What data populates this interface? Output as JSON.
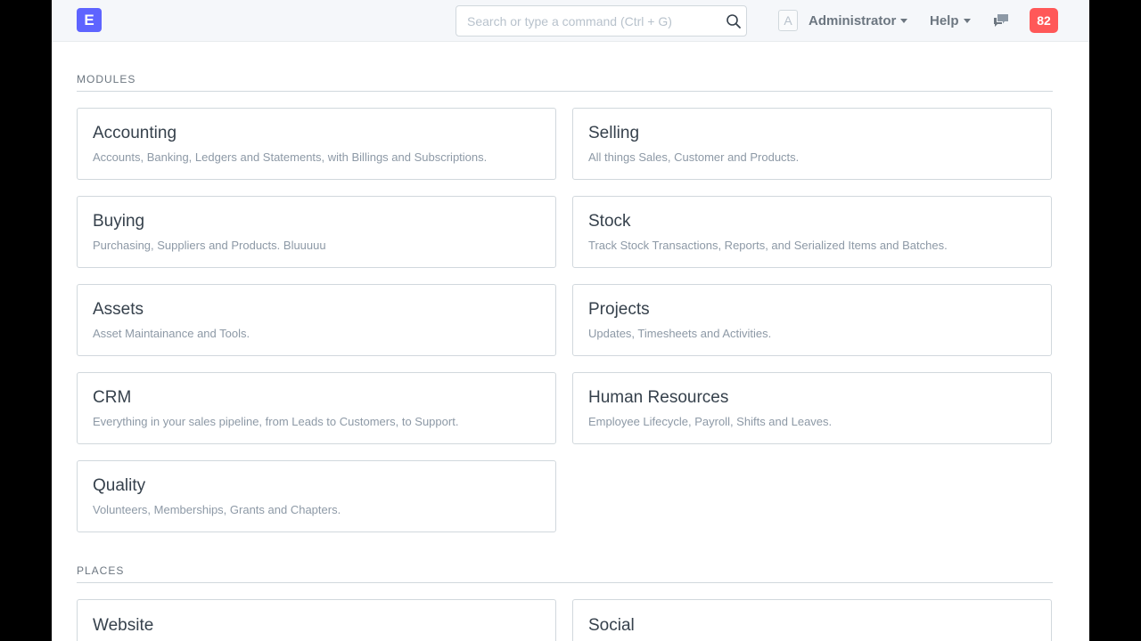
{
  "navbar": {
    "logo_letter": "E",
    "search_placeholder": "Search or type a command (Ctrl + G)",
    "avatar_letter": "A",
    "user_label": "Administrator",
    "help_label": "Help",
    "notification_count": "82",
    "colors": {
      "brand": "#5e64ff",
      "badge": "#ff5858"
    }
  },
  "sections": {
    "modules": {
      "heading": "MODULES",
      "cards": [
        {
          "title": "Accounting",
          "description": "Accounts, Banking, Ledgers and Statements, with Billings and Subscriptions."
        },
        {
          "title": "Selling",
          "description": "All things Sales, Customer and Products."
        },
        {
          "title": "Buying",
          "description": "Purchasing, Suppliers and Products. Bluuuuu"
        },
        {
          "title": "Stock",
          "description": "Track Stock Transactions, Reports, and Serialized Items and Batches."
        },
        {
          "title": "Assets",
          "description": "Asset Maintainance and Tools."
        },
        {
          "title": "Projects",
          "description": "Updates, Timesheets and Activities."
        },
        {
          "title": "CRM",
          "description": "Everything in your sales pipeline, from Leads to Customers, to Support."
        },
        {
          "title": "Human Resources",
          "description": "Employee Lifecycle, Payroll, Shifts and Leaves."
        },
        {
          "title": "Quality",
          "description": "Volunteers, Memberships, Grants and Chapters."
        }
      ]
    },
    "places": {
      "heading": "PLACES",
      "cards": [
        {
          "title": "Website"
        },
        {
          "title": "Social"
        }
      ]
    }
  }
}
